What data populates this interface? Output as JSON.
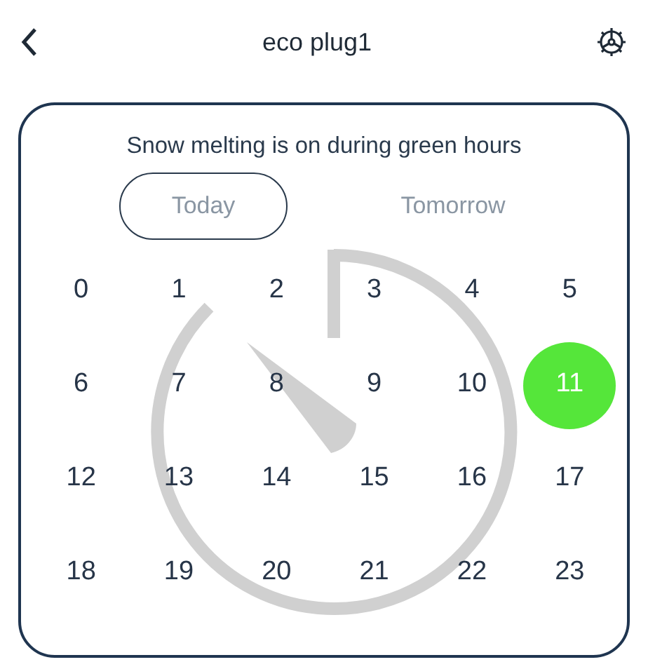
{
  "header": {
    "title": "eco plug1"
  },
  "schedule": {
    "message": "Snow melting is on during green hours",
    "tabs": [
      {
        "label": "Today",
        "selected": true
      },
      {
        "label": "Tomorrow",
        "selected": false
      }
    ],
    "hours": [
      {
        "label": "0",
        "on": false
      },
      {
        "label": "1",
        "on": false
      },
      {
        "label": "2",
        "on": false
      },
      {
        "label": "3",
        "on": false
      },
      {
        "label": "4",
        "on": false
      },
      {
        "label": "5",
        "on": false
      },
      {
        "label": "6",
        "on": false
      },
      {
        "label": "7",
        "on": false
      },
      {
        "label": "8",
        "on": false
      },
      {
        "label": "9",
        "on": false
      },
      {
        "label": "10",
        "on": false
      },
      {
        "label": "11",
        "on": true
      },
      {
        "label": "12",
        "on": false
      },
      {
        "label": "13",
        "on": false
      },
      {
        "label": "14",
        "on": false
      },
      {
        "label": "15",
        "on": false
      },
      {
        "label": "16",
        "on": false
      },
      {
        "label": "17",
        "on": false
      },
      {
        "label": "18",
        "on": false
      },
      {
        "label": "19",
        "on": false
      },
      {
        "label": "20",
        "on": false
      },
      {
        "label": "21",
        "on": false
      },
      {
        "label": "22",
        "on": false
      },
      {
        "label": "23",
        "on": false
      }
    ]
  }
}
